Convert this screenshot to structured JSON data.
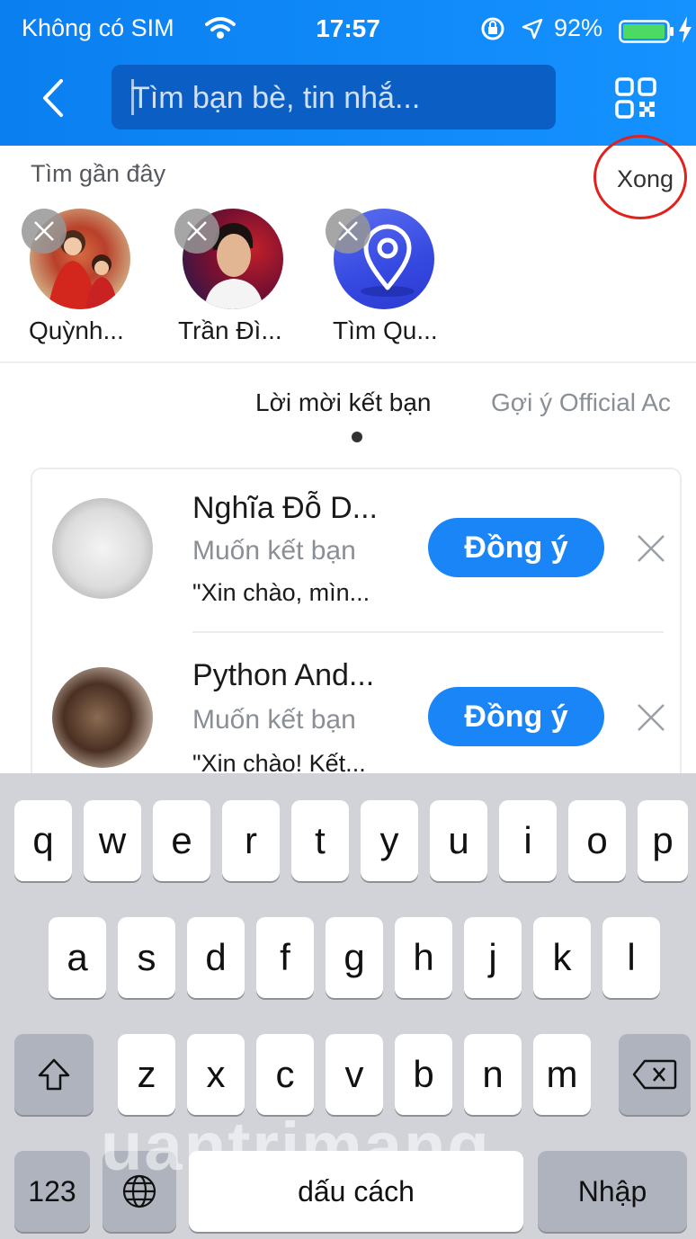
{
  "status_bar": {
    "carrier": "Không có SIM",
    "time": "17:57",
    "battery": "92%"
  },
  "header": {
    "search_placeholder": "Tìm bạn bè, tin nhắ..."
  },
  "recent": {
    "title": "Tìm gần đây",
    "done_label": "Xong",
    "items": [
      {
        "name": "Quỳnh..."
      },
      {
        "name": "Trần Đì..."
      },
      {
        "name": "Tìm Qu..."
      }
    ]
  },
  "tabs": {
    "invites": "Lời mời kết bạn",
    "official": "Gợi ý Official Ac"
  },
  "requests": [
    {
      "name": "Nghĩa Đỗ D...",
      "status": "Muốn kết bạn",
      "message": "\"Xin chào, mìn...",
      "accept": "Đồng ý"
    },
    {
      "name": "Python And...",
      "status": "Muốn kết bạn",
      "message": "\"Xin chào! Kết...",
      "accept": "Đồng ý"
    }
  ],
  "keyboard": {
    "row1": [
      "q",
      "w",
      "e",
      "r",
      "t",
      "y",
      "u",
      "i",
      "o",
      "p"
    ],
    "row2": [
      "a",
      "s",
      "d",
      "f",
      "g",
      "h",
      "j",
      "k",
      "l"
    ],
    "row3": [
      "z",
      "x",
      "c",
      "v",
      "b",
      "n",
      "m"
    ],
    "numbers": "123",
    "space": "dấu cách",
    "enter": "Nhập"
  },
  "watermark": "uantrimang",
  "colors": {
    "header_blue": "#1592ff",
    "accept_blue": "#1a85f6",
    "highlight_red": "#e0211d"
  }
}
